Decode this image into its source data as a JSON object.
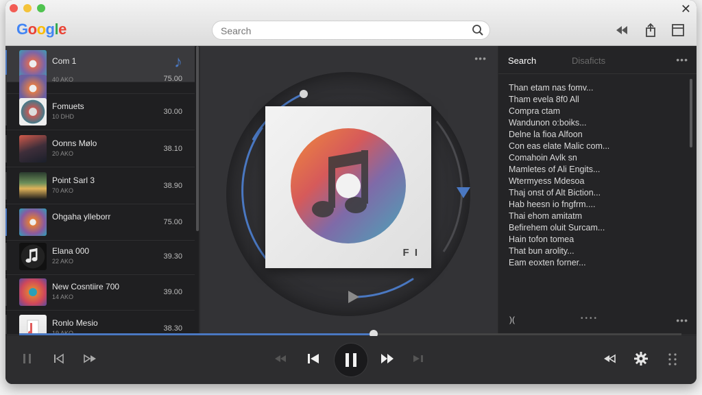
{
  "browser": {
    "logo_letters": [
      {
        "ch": "G",
        "color": "#4285F4"
      },
      {
        "ch": "o",
        "color": "#EA4335"
      },
      {
        "ch": "o",
        "color": "#FBBC05"
      },
      {
        "ch": "g",
        "color": "#4285F4"
      },
      {
        "ch": "l",
        "color": "#34A853"
      },
      {
        "ch": "e",
        "color": "#EA4335"
      }
    ],
    "search_placeholder": "Search",
    "close_glyph": "✕"
  },
  "tracks": [
    {
      "title": "Com 1",
      "sub": "",
      "value": "",
      "active": true,
      "marked": true,
      "indicator": "♪"
    },
    {
      "title": "",
      "sub": "40 AKO",
      "value": "75.00",
      "active": false,
      "marked": false
    },
    {
      "title": "Fomuets",
      "sub": "10 DHD",
      "value": "30.00",
      "active": false,
      "marked": false
    },
    {
      "title": "Oonns Mølo",
      "sub": "20 AKO",
      "value": "38.10",
      "active": false,
      "marked": false
    },
    {
      "title": "Point Sarl 3",
      "sub": "70 AKO",
      "value": "38.90",
      "active": false,
      "marked": false
    },
    {
      "title": "Ohgaha ylleborr",
      "sub": "",
      "value": "75.00",
      "active": false,
      "marked": true
    },
    {
      "title": "Elana 000",
      "sub": "22 AKO",
      "value": "39.30",
      "active": false,
      "marked": false
    },
    {
      "title": "New Cosntiire 700",
      "sub": "14 AKO",
      "value": "39.00",
      "active": false,
      "marked": false
    },
    {
      "title": "Ronlo Mesio",
      "sub": "19 AKO",
      "value": "38.30",
      "active": false,
      "marked": false
    }
  ],
  "player": {
    "album_label": "F I",
    "more_glyph": "•••",
    "progress": 0.535,
    "ring_progress": 0.2
  },
  "right_panel": {
    "tab_active": "Search",
    "tab_inactive": "Disaficts",
    "more_glyph": "•••",
    "lines": [
      "Than etam nas fomv...",
      "Tham evela 8f0 All",
      "Compra ctam",
      "Wandunon o:boiks...",
      "Delne la fioa Alfoon",
      "Con eas elate Malic com...",
      "Comahoin Avlk sn",
      "Mamletes of Ali Engits...",
      "Wtermyess Mdesoa",
      "Thaj onst of Alt Biction...",
      "Hab heesn io fngfrm....",
      "Thai ehom amitatm",
      "Befirehem oluit Surcam...",
      "Hain tofon tomea",
      "That bun arolity...",
      "Eam eoxten forner..."
    ],
    "footer_left": ")(",
    "footer_page": "••••",
    "footer_more": "•••"
  },
  "colors": {
    "accent": "#4a78c2",
    "background": "#2a2a2c"
  }
}
